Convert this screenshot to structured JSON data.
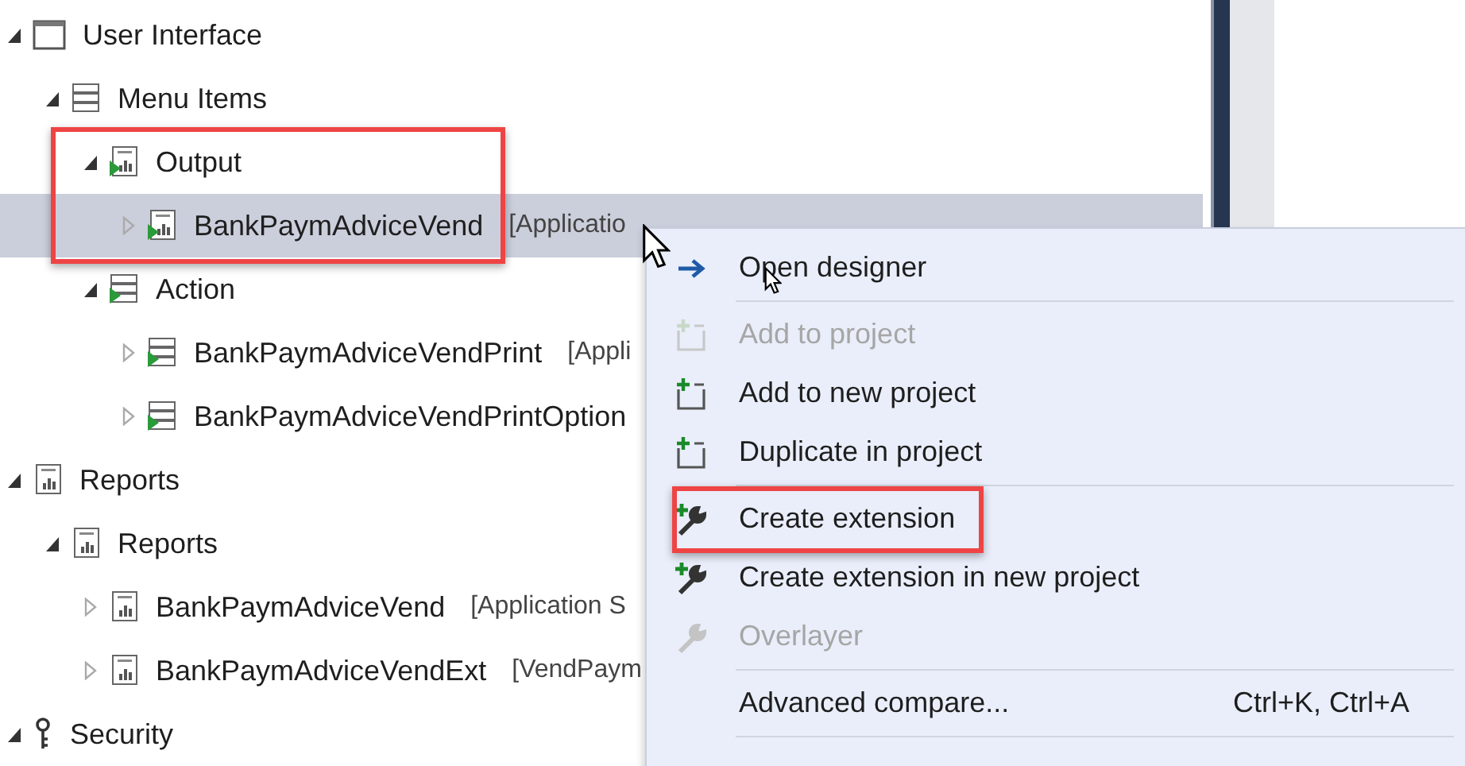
{
  "tree": [
    {
      "label": "User Interface",
      "kind": "window",
      "expanded": true,
      "selected": false,
      "highlighted": false,
      "children": [
        {
          "label": "Menu Items",
          "kind": "list",
          "expanded": true,
          "selected": false,
          "highlighted": false,
          "children": [
            {
              "label": "Output",
              "kind": "output",
              "expanded": true,
              "selected": false,
              "highlighted": true,
              "children": [
                {
                  "label": "BankPaymAdviceVend",
                  "detail": "[Applicatio",
                  "kind": "output",
                  "expanded": false,
                  "selected": true,
                  "highlighted": false
                }
              ]
            },
            {
              "label": "Action",
              "kind": "action",
              "expanded": true,
              "selected": false,
              "highlighted": false,
              "children": [
                {
                  "label": "BankPaymAdviceVendPrint",
                  "detail": "[Appli",
                  "kind": "action",
                  "expanded": false,
                  "selected": false,
                  "highlighted": false
                },
                {
                  "label": "BankPaymAdviceVendPrintOption",
                  "kind": "action",
                  "expanded": false,
                  "selected": false,
                  "highlighted": false
                }
              ]
            }
          ]
        }
      ]
    },
    {
      "label": "Reports",
      "kind": "report",
      "expanded": true,
      "selected": false,
      "highlighted": false,
      "children": [
        {
          "label": "Reports",
          "kind": "report",
          "expanded": true,
          "selected": false,
          "highlighted": false,
          "children": [
            {
              "label": "BankPaymAdviceVend",
              "detail": "[Application S",
              "kind": "report",
              "expanded": false,
              "selected": false,
              "highlighted": false
            },
            {
              "label": "BankPaymAdviceVendExt",
              "detail": "[VendPaym",
              "kind": "report",
              "expanded": false,
              "selected": false,
              "highlighted": false
            }
          ]
        }
      ]
    },
    {
      "label": "Security",
      "kind": "key",
      "expanded": true,
      "selected": false,
      "highlighted": false
    }
  ],
  "context_menu": {
    "items": [
      {
        "kind": "open",
        "label": "Open designer",
        "disabled": false,
        "highlighted": false
      },
      {
        "kind": "separator"
      },
      {
        "kind": "add",
        "label": "Add to project",
        "disabled": true,
        "highlighted": false
      },
      {
        "kind": "add",
        "label": "Add to new project",
        "disabled": false,
        "highlighted": false
      },
      {
        "kind": "add",
        "label": "Duplicate in project",
        "disabled": false,
        "highlighted": false
      },
      {
        "kind": "separator"
      },
      {
        "kind": "extend",
        "label": "Create extension",
        "disabled": false,
        "highlighted": true
      },
      {
        "kind": "extend",
        "label": "Create extension in new project",
        "disabled": false,
        "highlighted": false
      },
      {
        "kind": "wrench",
        "label": "Overlayer",
        "disabled": true,
        "highlighted": false
      },
      {
        "kind": "separator"
      },
      {
        "kind": "plain",
        "label": "Advanced compare...",
        "shortcut": "Ctrl+K, Ctrl+A",
        "disabled": false,
        "highlighted": false
      },
      {
        "kind": "separator"
      }
    ]
  }
}
